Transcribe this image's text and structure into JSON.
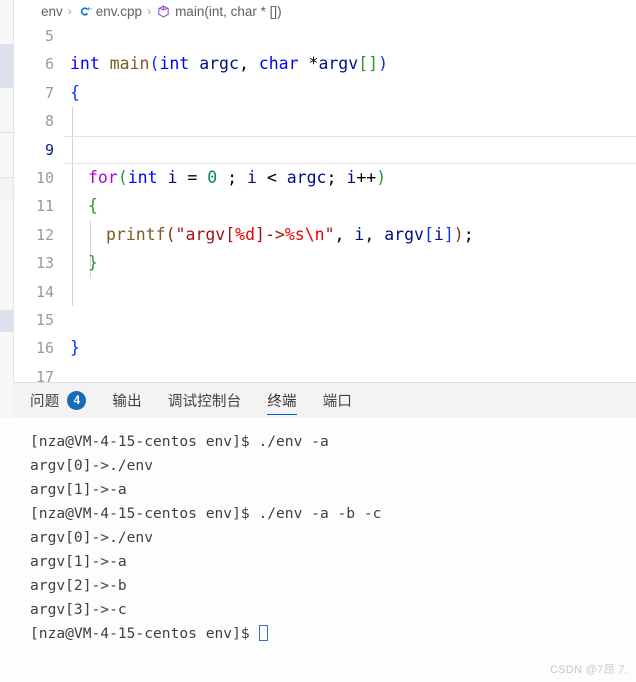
{
  "window": {
    "app": "vscode",
    "accent_color": "#005fb8"
  },
  "breadcrumb": {
    "items": [
      {
        "label": "env",
        "icon": ""
      },
      {
        "label": "env.cpp",
        "icon": "cpp-file-icon"
      },
      {
        "label": "main(int, char * [])",
        "icon": "method-symbol-icon"
      }
    ],
    "separator": "›"
  },
  "editor": {
    "language": "cpp",
    "active_line": 9,
    "first_visible_line": 5,
    "lines": [
      {
        "num": 5,
        "tokens": []
      },
      {
        "num": 6,
        "tokens": [
          {
            "t": "int",
            "c": "t-kw"
          },
          {
            "t": " ",
            "c": "t-plain"
          },
          {
            "t": "main",
            "c": "t-fn"
          },
          {
            "t": "(",
            "c": "t-p0"
          },
          {
            "t": "int",
            "c": "t-kw"
          },
          {
            "t": " ",
            "c": "t-plain"
          },
          {
            "t": "argc",
            "c": "t-id"
          },
          {
            "t": ", ",
            "c": "t-plain"
          },
          {
            "t": "char",
            "c": "t-kw"
          },
          {
            "t": " *",
            "c": "t-plain"
          },
          {
            "t": "argv",
            "c": "t-id"
          },
          {
            "t": "[]",
            "c": "t-p1"
          },
          {
            "t": ")",
            "c": "t-p0"
          }
        ]
      },
      {
        "num": 7,
        "tokens": [
          {
            "t": "{",
            "c": "t-p0"
          }
        ]
      },
      {
        "num": 8,
        "tokens": []
      },
      {
        "num": 9,
        "tokens": []
      },
      {
        "num": 10,
        "tokens": [
          {
            "t": "for",
            "c": "t-ctrl"
          },
          {
            "t": "(",
            "c": "t-p1"
          },
          {
            "t": "int",
            "c": "t-kw"
          },
          {
            "t": " ",
            "c": "t-plain"
          },
          {
            "t": "i",
            "c": "t-id"
          },
          {
            "t": " = ",
            "c": "t-plain"
          },
          {
            "t": "0",
            "c": "t-num"
          },
          {
            "t": " ; ",
            "c": "t-plain"
          },
          {
            "t": "i",
            "c": "t-id"
          },
          {
            "t": " < ",
            "c": "t-plain"
          },
          {
            "t": "argc",
            "c": "t-id"
          },
          {
            "t": "; ",
            "c": "t-plain"
          },
          {
            "t": "i",
            "c": "t-id"
          },
          {
            "t": "++",
            "c": "t-plain"
          },
          {
            "t": ")",
            "c": "t-p1"
          }
        ]
      },
      {
        "num": 11,
        "tokens": [
          {
            "t": "{",
            "c": "t-p1"
          }
        ]
      },
      {
        "num": 12,
        "tokens": [
          {
            "t": "printf",
            "c": "t-fn"
          },
          {
            "t": "(",
            "c": "t-p2"
          },
          {
            "t": "\"argv[",
            "c": "t-str"
          },
          {
            "t": "%d",
            "c": "t-esc"
          },
          {
            "t": "]->",
            "c": "t-str"
          },
          {
            "t": "%s",
            "c": "t-esc"
          },
          {
            "t": "\\n",
            "c": "t-esc"
          },
          {
            "t": "\"",
            "c": "t-str"
          },
          {
            "t": ", ",
            "c": "t-plain"
          },
          {
            "t": "i",
            "c": "t-id"
          },
          {
            "t": ", ",
            "c": "t-plain"
          },
          {
            "t": "argv",
            "c": "t-id"
          },
          {
            "t": "[",
            "c": "t-p0"
          },
          {
            "t": "i",
            "c": "t-id"
          },
          {
            "t": "]",
            "c": "t-p0"
          },
          {
            "t": ")",
            "c": "t-p2"
          },
          {
            "t": ";",
            "c": "t-plain"
          }
        ]
      },
      {
        "num": 13,
        "tokens": [
          {
            "t": "}",
            "c": "t-p1"
          }
        ]
      },
      {
        "num": 14,
        "tokens": []
      },
      {
        "num": 15,
        "tokens": []
      },
      {
        "num": 16,
        "tokens": [
          {
            "t": "}",
            "c": "t-p0"
          }
        ]
      },
      {
        "num": 17,
        "tokens": []
      }
    ]
  },
  "panel": {
    "tabs": [
      {
        "label": "问题",
        "badge": "4",
        "active": false
      },
      {
        "label": "输出",
        "badge": null,
        "active": false
      },
      {
        "label": "调试控制台",
        "badge": null,
        "active": false
      },
      {
        "label": "终端",
        "badge": null,
        "active": true
      },
      {
        "label": "端口",
        "badge": null,
        "active": false
      }
    ]
  },
  "terminal": {
    "prompt": "[nza@VM-4-15-centos env]$",
    "lines": [
      "[nza@VM-4-15-centos env]$ ./env -a",
      "argv[0]->./env",
      "argv[1]->-a",
      "[nza@VM-4-15-centos env]$ ./env -a -b -c",
      "argv[0]->./env",
      "argv[1]->-a",
      "argv[2]->-b",
      "argv[3]->-c"
    ],
    "last_prompt": "[nza@VM-4-15-centos env]$ ",
    "cursor": "block-outline"
  },
  "watermark": {
    "text": "CSDN @7昂 7."
  }
}
